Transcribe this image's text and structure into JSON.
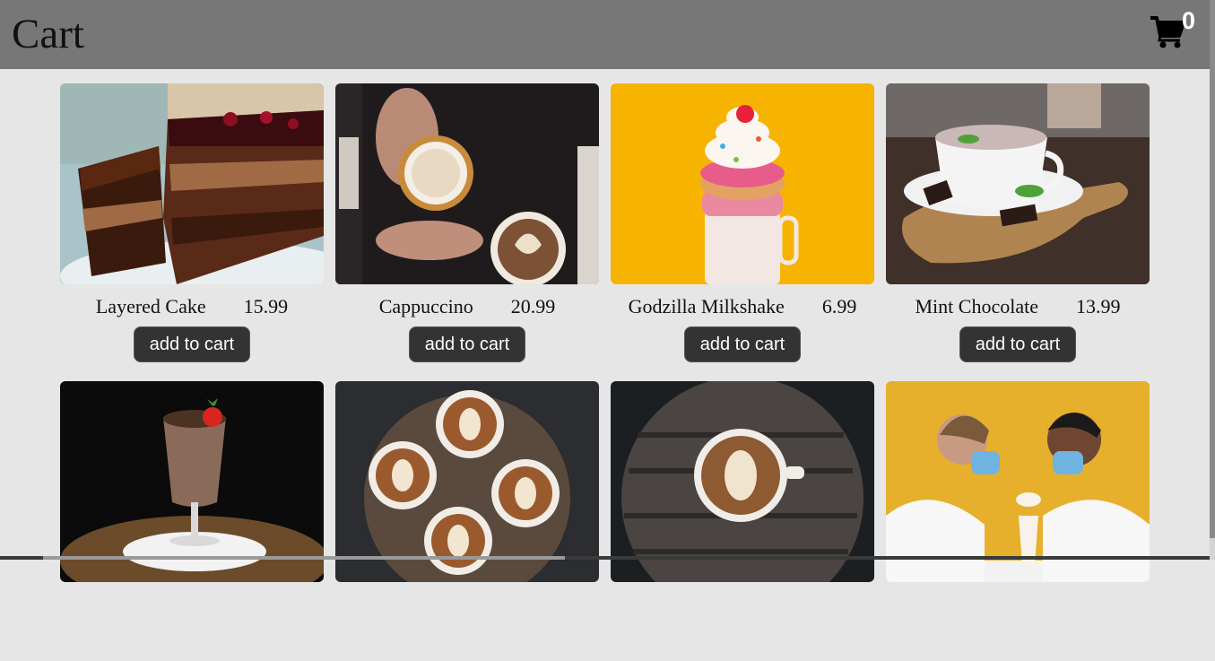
{
  "header": {
    "title": "Cart",
    "cart_count": "0",
    "cart_icon": "shopping-cart-icon"
  },
  "button_label": "add to cart",
  "products": [
    {
      "name": "Layered Cake",
      "price": "15.99",
      "image": "layered-cake-photo"
    },
    {
      "name": "Cappuccino",
      "price": "20.99",
      "image": "cappuccino-photo"
    },
    {
      "name": "Godzilla Milkshake",
      "price": "6.99",
      "image": "godzilla-milkshake-photo"
    },
    {
      "name": "Mint Chocolate",
      "price": "13.99",
      "image": "mint-chocolate-photo"
    },
    {
      "image": "chocolate-milkshake-photo"
    },
    {
      "image": "latte-art-cups-photo"
    },
    {
      "image": "latte-on-wooden-table-photo"
    },
    {
      "image": "couple-sharing-milkshake-photo"
    }
  ],
  "colors": {
    "header": "#777777",
    "background": "#e6e6e6",
    "button": "#333333",
    "button_text": "#ffffff"
  }
}
